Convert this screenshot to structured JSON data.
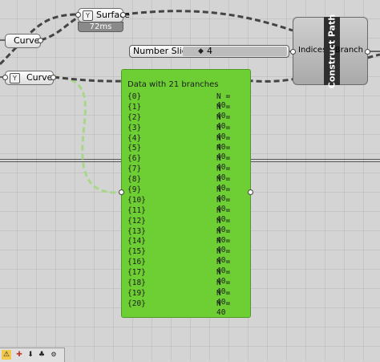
{
  "surface_param": {
    "label": "Surface",
    "icon": "param-y-icon",
    "time": "72ms"
  },
  "curve_param_1": {
    "label": "Curve"
  },
  "curve_param_2": {
    "label": "Curve",
    "icon": "param-y-icon"
  },
  "number_slider": {
    "label": "Number Slider",
    "grip": "◆",
    "value": "4"
  },
  "construct_path": {
    "title": "Construct Path",
    "input": "Indices",
    "output": "Branch"
  },
  "panel": {
    "header": "Data with 21 branches",
    "rows": [
      {
        "path": "{0}",
        "count": "N = 40"
      },
      {
        "path": "{1}",
        "count": "N = 40"
      },
      {
        "path": "{2}",
        "count": "N = 40"
      },
      {
        "path": "{3}",
        "count": "N = 40"
      },
      {
        "path": "{4}",
        "count": "N = 40"
      },
      {
        "path": "{5}",
        "count": "N = 40"
      },
      {
        "path": "{6}",
        "count": "N = 40"
      },
      {
        "path": "{7}",
        "count": "N = 40"
      },
      {
        "path": "{8}",
        "count": "N = 40"
      },
      {
        "path": "{9}",
        "count": "N = 40"
      },
      {
        "path": "{10}",
        "count": "N = 40"
      },
      {
        "path": "{11}",
        "count": "N = 40"
      },
      {
        "path": "{12}",
        "count": "N = 40"
      },
      {
        "path": "{13}",
        "count": "N = 40"
      },
      {
        "path": "{14}",
        "count": "N = 40"
      },
      {
        "path": "{15}",
        "count": "N = 40"
      },
      {
        "path": "{16}",
        "count": "N = 40"
      },
      {
        "path": "{17}",
        "count": "N = 40"
      },
      {
        "path": "{18}",
        "count": "N = 40"
      },
      {
        "path": "{19}",
        "count": "N = 40"
      },
      {
        "path": "{20}",
        "count": "N = 40"
      }
    ],
    "color": "#6dcf34"
  },
  "toolbar": {
    "icons": [
      "warning-icon",
      "add-icon",
      "import-icon",
      "tree-icon",
      "settings-icon"
    ]
  }
}
